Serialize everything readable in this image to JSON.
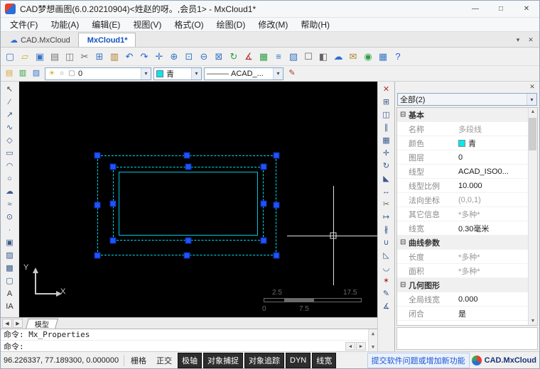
{
  "titlebar": {
    "title": "CAD梦想画图(6.0.20210904)<姓赵的呀。,会员1> - MxCloud1*",
    "minimize": "—",
    "maximize": "□",
    "close": "✕"
  },
  "menubar": {
    "items": [
      {
        "label": "文件(F)"
      },
      {
        "label": "功能(A)"
      },
      {
        "label": "编辑(E)"
      },
      {
        "label": "视图(V)"
      },
      {
        "label": "格式(O)"
      },
      {
        "label": "绘图(D)"
      },
      {
        "label": "修改(M)"
      },
      {
        "label": "帮助(H)"
      }
    ]
  },
  "doc_tabs": {
    "items": [
      {
        "label": "CAD.MxCloud",
        "icon": "☁",
        "active": false
      },
      {
        "label": "MxCloud1*",
        "icon": "",
        "active": true
      }
    ],
    "overflow": "▾",
    "close": "✕"
  },
  "toolbar_main": {
    "icons": [
      {
        "name": "new-file-icon",
        "glyph": "▢",
        "color": "#3a76c4"
      },
      {
        "name": "open-file-icon",
        "glyph": "▱",
        "color": "#d9a43a"
      },
      {
        "name": "save-icon",
        "glyph": "▣",
        "color": "#3a76c4"
      },
      {
        "name": "plot-icon",
        "glyph": "▤",
        "color": "#777777"
      },
      {
        "name": "print-preview-icon",
        "glyph": "◫",
        "color": "#777777"
      },
      {
        "name": "cut-icon",
        "glyph": "✂",
        "color": "#666666"
      },
      {
        "name": "copy-icon",
        "glyph": "⊞",
        "color": "#3a76c4"
      },
      {
        "name": "paste-icon",
        "glyph": "▥",
        "color": "#b08030"
      },
      {
        "name": "undo-icon",
        "glyph": "↶",
        "color": "#2a5fd0"
      },
      {
        "name": "redo-icon",
        "glyph": "↷",
        "color": "#2a5fd0"
      },
      {
        "name": "pan-icon",
        "glyph": "✛",
        "color": "#3a76c4"
      },
      {
        "name": "zoom-realtime-icon",
        "glyph": "⊕",
        "color": "#3a76c4"
      },
      {
        "name": "zoom-window-icon",
        "glyph": "⊡",
        "color": "#3a76c4"
      },
      {
        "name": "zoom-out-icon",
        "glyph": "⊖",
        "color": "#3a76c4"
      },
      {
        "name": "zoom-extents-icon",
        "glyph": "⊠",
        "color": "#3a76c4"
      },
      {
        "name": "regen-icon",
        "glyph": "↻",
        "color": "#2f9e44"
      },
      {
        "name": "measure-icon",
        "glyph": "∡",
        "color": "#b03030"
      },
      {
        "name": "area-icon",
        "glyph": "▦",
        "color": "#2f9e44"
      },
      {
        "name": "layer-manager-icon",
        "glyph": "≡",
        "color": "#3a76c4"
      },
      {
        "name": "properties-palette-icon",
        "glyph": "▧",
        "color": "#3a76c4"
      },
      {
        "name": "osnap-settings-icon",
        "glyph": "☐",
        "color": "#666666"
      },
      {
        "name": "draworder-icon",
        "glyph": "◧",
        "color": "#666666"
      },
      {
        "name": "cloud-icon",
        "glyph": "☁",
        "color": "#2a6fd6"
      },
      {
        "name": "share-icon",
        "glyph": "✉",
        "color": "#b08030"
      },
      {
        "name": "web-icon",
        "glyph": "◉",
        "color": "#2f9e44"
      },
      {
        "name": "grid-display-icon",
        "glyph": "▦",
        "color": "#3a76c4"
      },
      {
        "name": "help-icon",
        "glyph": "?",
        "color": "#2a5fd0"
      }
    ]
  },
  "toolbar_format": {
    "layer_icons": [
      {
        "name": "layer-properties-icon",
        "glyph": "▤",
        "color": "#d9a43a"
      },
      {
        "name": "layer-states-icon",
        "glyph": "▥",
        "color": "#2f9e44"
      },
      {
        "name": "layer-isolate-icon",
        "glyph": "▨",
        "color": "#3a76c4"
      }
    ],
    "layer_select": {
      "icons": [
        {
          "name": "layer-on-icon",
          "glyph": "☀",
          "color": "#d9a414"
        },
        {
          "name": "layer-freeze-icon",
          "glyph": "○",
          "color": "#888888"
        },
        {
          "name": "layer-lock-icon",
          "glyph": "▢",
          "color": "#888888"
        }
      ],
      "value": "0",
      "arrow": "▾"
    },
    "color_select": {
      "value": "青",
      "arrow": "▾"
    },
    "linetype_select": {
      "pattern": "———",
      "value": "ACAD_...",
      "arrow": "▾"
    },
    "match_glyph": "✎"
  },
  "draw_toolbar": {
    "icons": [
      {
        "name": "pointer-icon",
        "glyph": "↖",
        "color": "#444444"
      },
      {
        "name": "line-icon",
        "glyph": "∕",
        "color": "#3a5a8c"
      },
      {
        "name": "ray-icon",
        "glyph": "↗",
        "color": "#3a5a8c"
      },
      {
        "name": "polyline-icon",
        "glyph": "∿",
        "color": "#3a5a8c"
      },
      {
        "name": "polygon-icon",
        "glyph": "◇",
        "color": "#3a5a8c"
      },
      {
        "name": "rectangle-icon",
        "glyph": "▭",
        "color": "#3a5a8c"
      },
      {
        "name": "arc-icon",
        "glyph": "◠",
        "color": "#3a5a8c"
      },
      {
        "name": "circle-icon",
        "glyph": "○",
        "color": "#3a5a8c"
      },
      {
        "name": "revcloud-icon",
        "glyph": "☁",
        "color": "#3a5a8c"
      },
      {
        "name": "spline-icon",
        "glyph": "≈",
        "color": "#3a5a8c"
      },
      {
        "name": "ellipse-icon",
        "glyph": "⊙",
        "color": "#3a5a8c"
      },
      {
        "name": "point-icon",
        "glyph": "∙",
        "color": "#3a5a8c"
      },
      {
        "name": "block-icon",
        "glyph": "▣",
        "color": "#3a5a8c"
      },
      {
        "name": "hatch-icon",
        "glyph": "▨",
        "color": "#3a5a8c"
      },
      {
        "name": "gradient-icon",
        "glyph": "▩",
        "color": "#3a5a8c"
      },
      {
        "name": "region-icon",
        "glyph": "▢",
        "color": "#3a5a8c"
      },
      {
        "name": "mtext-icon",
        "glyph": "A",
        "color": "#2f2f2f"
      },
      {
        "name": "text-icon",
        "glyph": "IA",
        "color": "#2f2f2f"
      }
    ]
  },
  "modify_toolbar": {
    "icons": [
      {
        "name": "erase-icon",
        "glyph": "✕",
        "color": "#b03030"
      },
      {
        "name": "copy-object-icon",
        "glyph": "⊞",
        "color": "#3a5a8c"
      },
      {
        "name": "mirror-icon",
        "glyph": "◫",
        "color": "#3a5a8c"
      },
      {
        "name": "offset-icon",
        "glyph": "∥",
        "color": "#3a5a8c"
      },
      {
        "name": "array-icon",
        "glyph": "▦",
        "color": "#3a5a8c"
      },
      {
        "name": "move-icon",
        "glyph": "✛",
        "color": "#3a5a8c"
      },
      {
        "name": "rotate-icon",
        "glyph": "↻",
        "color": "#3a5a8c"
      },
      {
        "name": "scale-icon",
        "glyph": "◣",
        "color": "#3a5a8c"
      },
      {
        "name": "stretch-icon",
        "glyph": "↔",
        "color": "#3a5a8c"
      },
      {
        "name": "trim-icon",
        "glyph": "✂",
        "color": "#666666"
      },
      {
        "name": "extend-icon",
        "glyph": "↦",
        "color": "#3a5a8c"
      },
      {
        "name": "break-icon",
        "glyph": "∦",
        "color": "#3a5a8c"
      },
      {
        "name": "join-icon",
        "glyph": "∪",
        "color": "#3a5a8c"
      },
      {
        "name": "chamfer-icon",
        "glyph": "◺",
        "color": "#3a5a8c"
      },
      {
        "name": "fillet-icon",
        "glyph": "◡",
        "color": "#3a5a8c"
      },
      {
        "name": "explode-icon",
        "glyph": "✶",
        "color": "#b03030"
      },
      {
        "name": "match-properties-icon",
        "glyph": "✎",
        "color": "#3a5a8c"
      },
      {
        "name": "measure-tool-icon",
        "glyph": "∡",
        "color": "#3a5a8c"
      }
    ]
  },
  "canvas": {
    "ucs": {
      "x_label": "X",
      "y_label": "Y"
    },
    "scale_bar": {
      "top_left": "2.5",
      "top_right": "17.5",
      "bottom_left": "0",
      "bottom_mid": "7.5"
    }
  },
  "properties_panel": {
    "close": "✕",
    "filter": {
      "value": "全部(2)",
      "arrow": "▾"
    },
    "scroll_up": "▲",
    "scroll_down": "▼",
    "rows": [
      {
        "isSection": true,
        "collapse": "⊟",
        "label": "基本",
        "value": ""
      },
      {
        "label": "名称",
        "value": "多段线",
        "readonly": true
      },
      {
        "label": "颜色",
        "value": "青",
        "swatch": true
      },
      {
        "label": "图层",
        "value": "0"
      },
      {
        "label": "线型",
        "value": "ACAD_ISO0..."
      },
      {
        "label": "线型比例",
        "value": "10.000"
      },
      {
        "label": "法向坐标",
        "value": "(0,0,1)",
        "readonly": true
      },
      {
        "label": "其它信息",
        "value": "*多种*",
        "readonly": true
      },
      {
        "label": "线宽",
        "value": "0.30毫米"
      },
      {
        "isSection": true,
        "collapse": "⊟",
        "label": "曲线参数",
        "value": ""
      },
      {
        "label": "长度",
        "value": "*多种*",
        "readonly": true
      },
      {
        "label": "面积",
        "value": "*多种*",
        "readonly": true
      },
      {
        "isSection": true,
        "collapse": "⊟",
        "label": "几何图形",
        "value": ""
      },
      {
        "label": "全局线宽",
        "value": "0.000"
      },
      {
        "label": "闭合",
        "value": "是"
      }
    ]
  },
  "layout_tabs": {
    "back": "◀",
    "forward": "▶",
    "model_label": "模型"
  },
  "command": {
    "history": "命令: Mx_Properties",
    "prompt": "命令:",
    "up": "▲",
    "down": "▼",
    "left": "◀",
    "right": "▶"
  },
  "statusbar": {
    "coords": "96.226337, 77.189300, 0.000000",
    "toggles": [
      {
        "label": "栅格",
        "active": false
      },
      {
        "label": "正交",
        "active": false
      },
      {
        "label": "极轴",
        "active": true
      },
      {
        "label": "对象捕捉",
        "active": true
      },
      {
        "label": "对象追踪",
        "active": true
      },
      {
        "label": "DYN",
        "active": true
      },
      {
        "label": "线宽",
        "active": true
      }
    ],
    "feedback_link": "提交软件问题或增加新功能",
    "brand": "CAD.MxCloud"
  }
}
